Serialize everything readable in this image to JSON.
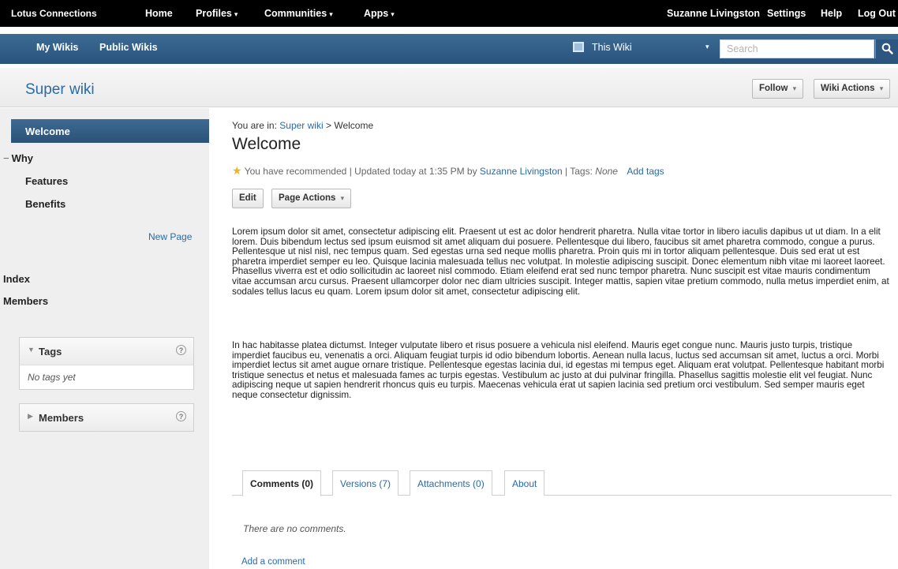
{
  "topnav": {
    "brand": "Lotus Connections",
    "items": [
      {
        "label": "Home",
        "caret": false
      },
      {
        "label": "Profiles",
        "caret": true
      },
      {
        "label": "Communities",
        "caret": true
      },
      {
        "label": "Apps",
        "caret": true
      }
    ],
    "user": "Suzanne Livingston",
    "settings": "Settings",
    "help": "Help",
    "logout": "Log Out"
  },
  "wikibar": {
    "tabs": [
      "My Wikis",
      "Public Wikis"
    ],
    "scope": "This Wiki",
    "search_placeholder": "Search"
  },
  "header": {
    "wiki_title": "Super wiki",
    "follow": "Follow",
    "wiki_actions": "Wiki Actions"
  },
  "sidebar": {
    "welcome": "Welcome",
    "why": "Why",
    "features": "Features",
    "benefits": "Benefits",
    "new_page": "New Page",
    "index": "Index",
    "members": "Members",
    "tags_panel": {
      "title": "Tags",
      "empty": "No tags yet"
    },
    "members_panel": {
      "title": "Members"
    }
  },
  "page": {
    "breadcrumb_prefix": "You are in:",
    "breadcrumb_wiki": "Super wiki",
    "breadcrumb_sep": ">",
    "breadcrumb_page": "Welcome",
    "title": "Welcome",
    "recommended": "You have recommended",
    "updated": "Updated today at 1:35 PM by",
    "author": "Suzanne Livingston",
    "tags_label": "Tags:",
    "tags_value": "None",
    "add_tags": "Add tags",
    "edit": "Edit",
    "page_actions": "Page Actions",
    "paragraph1": "Lorem ipsum dolor sit amet, consectetur adipiscing elit. Praesent ut est ac dolor hendrerit pharetra. Nulla vitae tortor in libero iaculis dapibus ut ut diam. In a elit lorem. Duis bibendum lectus sed ipsum euismod sit amet aliquam dui posuere. Pellentesque dui libero, faucibus sit amet pharetra commodo, congue a purus. Pellentesque ut nisl nisl, nec tempus quam. Sed egestas urna sed neque mollis pharetra. Proin quis mi in tortor aliquam pellentesque. Duis sed erat ut est pharetra imperdiet semper eu leo. Quisque lacinia malesuada tellus nec volutpat. In molestie adipiscing suscipit. Donec elementum nibh vitae mi laoreet laoreet. Phasellus viverra est et odio sollicitudin ac laoreet nisl commodo. Etiam eleifend erat sed nunc tempor pharetra. Nunc suscipit est vitae mauris condimentum vitae accumsan arcu cursus. Praesent ullamcorper dolor nec diam ultricies suscipit. Integer mattis, sapien vitae pretium commodo, nulla metus imperdiet enim, at sodales tellus lacus eu quam. Lorem ipsum dolor sit amet, consectetur adipiscing elit.",
    "paragraph2": "In hac habitasse platea dictumst. Integer vulputate libero et risus posuere a vehicula nisl eleifend. Mauris eget congue nunc. Mauris justo turpis, tristique imperdiet faucibus eu, venenatis a orci. Aliquam feugiat turpis id odio bibendum lobortis. Aenean nulla lacus, luctus sed accumsan sit amet, luctus a orci. Morbi imperdiet lectus sit amet augue ornare tristique. Pellentesque egestas lacinia dui, id egestas mi tempus eget. Aliquam erat volutpat. Pellentesque habitant morbi tristique senectus et netus et malesuada fames ac turpis egestas. Vestibulum ac justo at dui pulvinar fringilla. Phasellus sagittis molestie elit vel feugiat. Nunc adipiscing neque ut sapien hendrerit rhoncus quis eu turpis. Maecenas vehicula erat ut sapien lacinia sed pretium orci vestibulum. Sed semper mauris eget neque consectetur dignissim."
  },
  "tabs": {
    "comments": "Comments (0)",
    "versions": "Versions (7)",
    "attachments": "Attachments (0)",
    "about": "About"
  },
  "comments": {
    "empty": "There are no comments.",
    "add": "Add a comment"
  },
  "colors": {
    "topbar": "#000000",
    "wikibar": "#2f5a83",
    "link": "#2a6aa5",
    "star": "#e7b52c"
  }
}
